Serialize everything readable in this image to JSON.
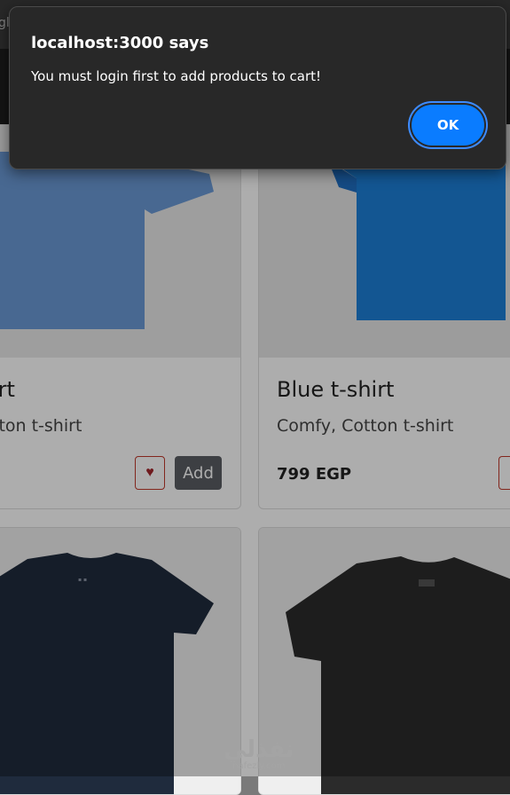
{
  "browser": {
    "tab_fragment": "gle"
  },
  "dialog": {
    "title": "localhost:3000 says",
    "message": "You must login first to add products to cart!",
    "ok_label": "OK"
  },
  "products": [
    {
      "title": "irt",
      "description": "tton t-shirt",
      "add_label": "Add",
      "heart": "♥",
      "shirt_color": "#5f8fd0"
    },
    {
      "title": "Blue t-shirt",
      "description": "Comfy, Cotton t-shirt",
      "price": "799 EGP",
      "shirt_color": "#1c7fdb"
    },
    {
      "shirt_color": "#1f2a3c"
    },
    {
      "shirt_color": "#2a2a2a"
    }
  ],
  "watermark": {
    "arabic": "نفذلي",
    "latin": "nafezly.com"
  }
}
